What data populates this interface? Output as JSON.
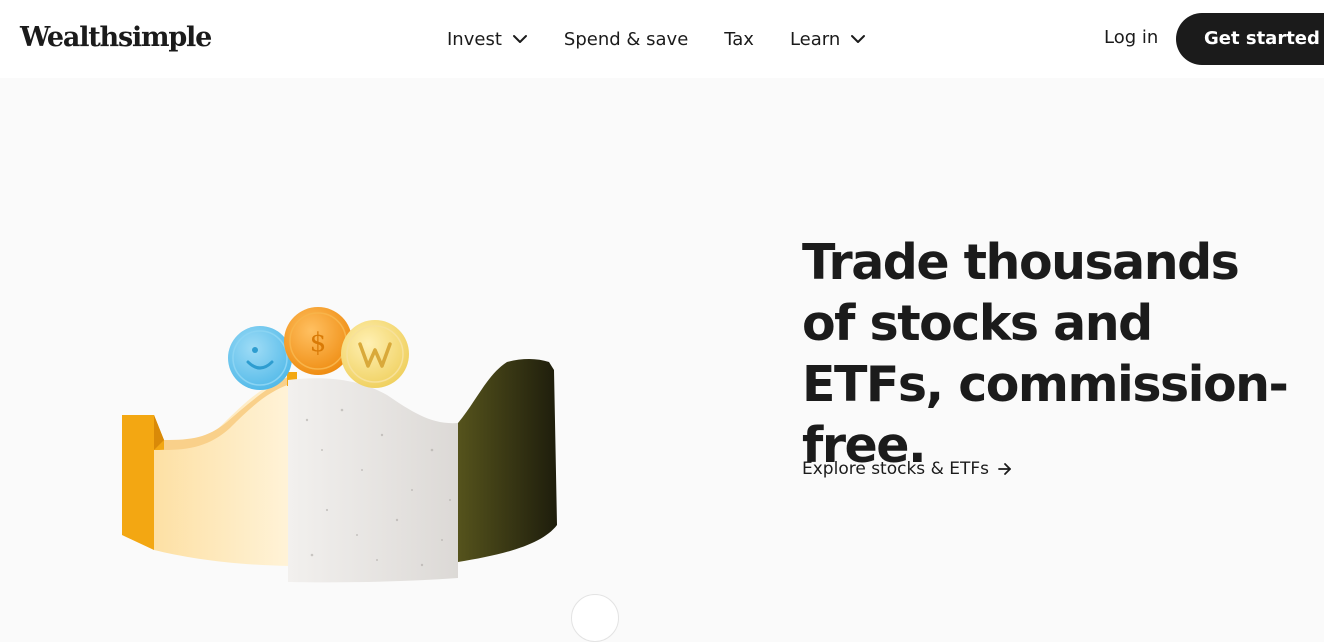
{
  "header": {
    "logo": "Wealthsimple",
    "nav": [
      {
        "label": "Invest",
        "has_dropdown": true
      },
      {
        "label": "Spend & save",
        "has_dropdown": false
      },
      {
        "label": "Tax",
        "has_dropdown": false
      },
      {
        "label": "Learn",
        "has_dropdown": true
      }
    ],
    "login_label": "Log in",
    "cta_label": "Get started"
  },
  "hero": {
    "headline": "Trade thousands of stocks and ETFs, commission-free.",
    "link_label": "Explore stocks & ETFs"
  },
  "colors": {
    "text": "#1b1b1b",
    "cta_background": "#1b1b1b",
    "page_background": "#fafafa",
    "coin_blue": "#6cc7ee",
    "coin_orange": "#f59a1c",
    "coin_yellow": "#f5d877"
  },
  "icons": {
    "nav_dropdown": "chevron-down-icon",
    "link_arrow": "arrow-right-icon"
  }
}
